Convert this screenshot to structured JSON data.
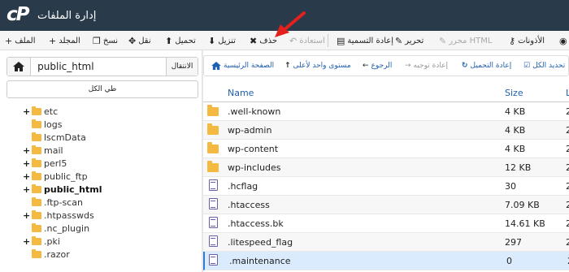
{
  "header": {
    "logo_text": "cP",
    "title": "إدارة الملفات"
  },
  "toolbar": {
    "items": [
      {
        "label": "الملف",
        "icon": "plus",
        "disabled": false
      },
      {
        "label": "المجلد",
        "icon": "plus",
        "disabled": false
      },
      {
        "label": "نسخ",
        "icon": "copy",
        "disabled": false
      },
      {
        "label": "نقل",
        "icon": "move",
        "disabled": false
      },
      {
        "label": "تحميل",
        "icon": "upload",
        "disabled": false
      },
      {
        "label": "تنزيل",
        "icon": "download",
        "disabled": false
      },
      {
        "label": "حذف",
        "icon": "times",
        "disabled": false
      },
      {
        "label": "استعادة",
        "icon": "undo",
        "disabled": true
      },
      {
        "label": "إعادة التسمية",
        "icon": "file",
        "disabled": false
      },
      {
        "label": "تحرير",
        "icon": "pencil",
        "disabled": false
      },
      {
        "label": "محرر HTML",
        "icon": "pencil",
        "disabled": true
      },
      {
        "label": "الأذونات",
        "icon": "key",
        "disabled": false
      },
      {
        "label": "",
        "icon": "eye",
        "disabled": false
      }
    ]
  },
  "left_panel": {
    "home_icon": "home-icon",
    "path_value": "public_html",
    "go_label": "الانتقال",
    "collapse_label": "طي الكل",
    "tree": [
      {
        "label": "etc",
        "plus": true,
        "bold": false
      },
      {
        "label": "logs",
        "plus": false,
        "bold": false
      },
      {
        "label": "lscmData",
        "plus": false,
        "bold": false
      },
      {
        "label": "mail",
        "plus": true,
        "bold": false
      },
      {
        "label": "perl5",
        "plus": true,
        "bold": false
      },
      {
        "label": "public_ftp",
        "plus": true,
        "bold": false
      },
      {
        "label": "public_html",
        "plus": true,
        "bold": true
      },
      {
        "label": ".ftp-scan",
        "plus": false,
        "bold": false
      },
      {
        "label": ".htpasswds",
        "plus": true,
        "bold": false
      },
      {
        "label": ".nc_plugin",
        "plus": false,
        "bold": false
      },
      {
        "label": ".pki",
        "plus": true,
        "bold": false
      },
      {
        "label": ".razor",
        "plus": false,
        "bold": false
      }
    ]
  },
  "nav": {
    "items": [
      {
        "label": "الصفحة الرئيسية",
        "icon": "home-icon",
        "disabled": false
      },
      {
        "label": "مستوى واحد لأعلى",
        "icon": "level-up-icon",
        "disabled": false
      },
      {
        "label": "الرجوع",
        "icon": "back-arrow-icon",
        "disabled": false
      },
      {
        "label": "إعادة توجيه",
        "icon": "forward-arrow-icon",
        "disabled": true
      },
      {
        "label": "إعادة التحميل",
        "icon": "refresh-icon",
        "disabled": false
      },
      {
        "label": "تحديد الكل",
        "icon": "checkbox-icon",
        "disabled": false
      }
    ]
  },
  "table": {
    "columns": {
      "name": "Name",
      "size": "Size",
      "last": "L"
    },
    "rows": [
      {
        "name": ".well-known",
        "size": "4 KB",
        "type": "folder"
      },
      {
        "name": "wp-admin",
        "size": "4 KB",
        "type": "folder"
      },
      {
        "name": "wp-content",
        "size": "4 KB",
        "type": "folder"
      },
      {
        "name": "wp-includes",
        "size": "12 KB",
        "type": "folder"
      },
      {
        "name": ".hcflag",
        "size": "30",
        "type": "file"
      },
      {
        "name": ".htaccess",
        "size": "7.09 KB",
        "type": "file"
      },
      {
        "name": ".htaccess.bk",
        "size": "14.61 KB",
        "type": "file"
      },
      {
        "name": ".litespeed_flag",
        "size": "297",
        "type": "file"
      },
      {
        "name": ".maintenance",
        "size": "0",
        "type": "file"
      }
    ],
    "selected_index": 8
  },
  "colors": {
    "header_bg": "#293a4a",
    "folder": "#f4b940",
    "file_icon": "#6b5fa6",
    "link": "#1f5fb0",
    "selection": "#d9ebfc",
    "arrow": "#e3201b"
  }
}
